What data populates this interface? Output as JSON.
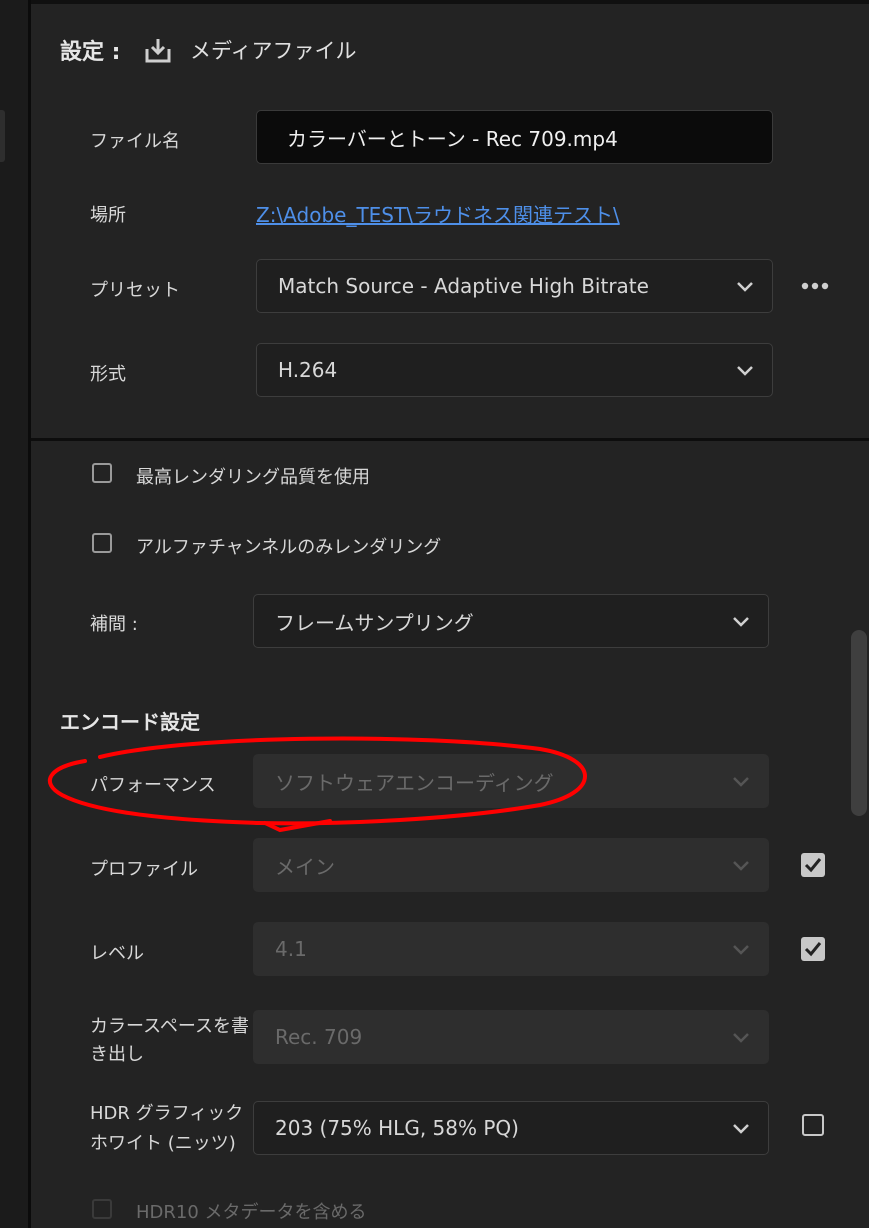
{
  "header": {
    "settings_label": "設定 :",
    "icon": "download-icon",
    "title": "メディアファイル"
  },
  "file": {
    "filename_label": "ファイル名",
    "filename_value": "カラーバーとトーン - Rec 709.mp4",
    "location_label": "場所",
    "location_value": "Z:\\Adobe_TEST\\ラウドネス関連テスト\\",
    "preset_label": "プリセット",
    "preset_value": "Match Source - Adaptive High Bitrate",
    "more_icon": "more-horizontal-icon",
    "format_label": "形式",
    "format_value": "H.264"
  },
  "render": {
    "max_quality_label": "最高レンダリング品質を使用",
    "max_quality_checked": false,
    "alpha_only_label": "アルファチャンネルのみレンダリング",
    "alpha_only_checked": false,
    "interpolation_label": "補間 :",
    "interpolation_value": "フレームサンプリング"
  },
  "encode": {
    "section_title": "エンコード設定",
    "performance_label": "パフォーマンス",
    "performance_value": "ソフトウェアエンコーディング",
    "profile_label": "プロファイル",
    "profile_value": "メイン",
    "profile_auto_checked": true,
    "level_label": "レベル",
    "level_value": "4.1",
    "level_auto_checked": true,
    "colorspace_label_line1": "カラースペースを書",
    "colorspace_label_line2": "き出し",
    "colorspace_value": "Rec. 709",
    "hdr_label_line1": "HDR グラフィック",
    "hdr_label_line2": "ホワイト (ニッツ)",
    "hdr_value": "203 (75% HLG, 58% PQ)",
    "hdr_checked": false,
    "hdr10_label": "HDR10 メタデータを含める",
    "hdr10_checked": false
  },
  "colors": {
    "panel_bg": "#232323",
    "link": "#4e8fe8",
    "annotation_red": "#ff0000"
  }
}
